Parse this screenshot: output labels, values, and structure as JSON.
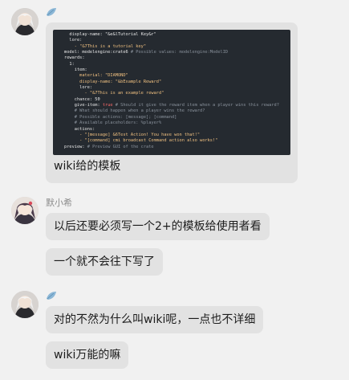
{
  "messages": [
    {
      "sender": "",
      "avatar": "anime-avatar-1",
      "image": {
        "code_lines": [
          [
            {
              "t": "  display-name: \"&e&lTutorial Key&r\"",
              "c": "k"
            }
          ],
          [
            {
              "t": "  lore:",
              "c": "k"
            }
          ],
          [
            {
              "t": "    - \"&7This is a tutorial key\"",
              "c": "s"
            }
          ],
          [
            {
              "t": "model: modelengine:crate6 ",
              "c": "k"
            },
            {
              "t": "# Possible values: modelengine:ModelID",
              "c": "c"
            }
          ],
          [
            {
              "t": "rewards:",
              "c": "k"
            }
          ],
          [
            {
              "t": "  1:",
              "c": "k"
            }
          ],
          [
            {
              "t": "    item:",
              "c": "k"
            }
          ],
          [
            {
              "t": "      material: \"DIAMOND\"",
              "c": "s"
            }
          ],
          [
            {
              "t": "      display-name: \"&bExample Reward\"",
              "c": "s"
            }
          ],
          [
            {
              "t": "      lore:",
              "c": "k"
            }
          ],
          [
            {
              "t": "        - \"&7This is an example reward\"",
              "c": "s"
            }
          ],
          [
            {
              "t": "    chance: 50",
              "c": "k"
            }
          ],
          [
            {
              "t": "    give-item: ",
              "c": "k"
            },
            {
              "t": "true",
              "c": "r"
            },
            {
              "t": " # Should it give the reward item when a player wins this reward?",
              "c": "c"
            }
          ],
          [
            {
              "t": "    # What should happen when a player wins the reward?",
              "c": "c"
            }
          ],
          [
            {
              "t": "    # Possible actions: [message]; [command]",
              "c": "c"
            }
          ],
          [
            {
              "t": "    # Available placeholders: %player%",
              "c": "c"
            }
          ],
          [
            {
              "t": "    actions:",
              "c": "k"
            }
          ],
          [
            {
              "t": "      - \"[message] &6Test Action! You have won that!\"",
              "c": "s"
            }
          ],
          [
            {
              "t": "      - \"[command] cmi broadcast Command action also works!\"",
              "c": "s"
            }
          ],
          [
            {
              "t": "preview: ",
              "c": "k"
            },
            {
              "t": "# Preview GUI of the crate",
              "c": "c"
            }
          ]
        ],
        "caption": "wiki给的模板"
      }
    },
    {
      "sender": "默小希",
      "avatar": "anime-avatar-2",
      "texts": [
        "以后还要必须写一个2+的模板给使用者看",
        "一个就不会往下写了"
      ]
    },
    {
      "sender": "",
      "avatar": "anime-avatar-1",
      "texts": [
        "对的不然为什么叫wiki呢，一点也不详细",
        "wiki万能的嘛"
      ]
    }
  ],
  "colors": {
    "background": "#f1f1f1",
    "bubble": "#e2e2e2",
    "name": "#8c8c8c",
    "code_bg": "#252a30"
  }
}
